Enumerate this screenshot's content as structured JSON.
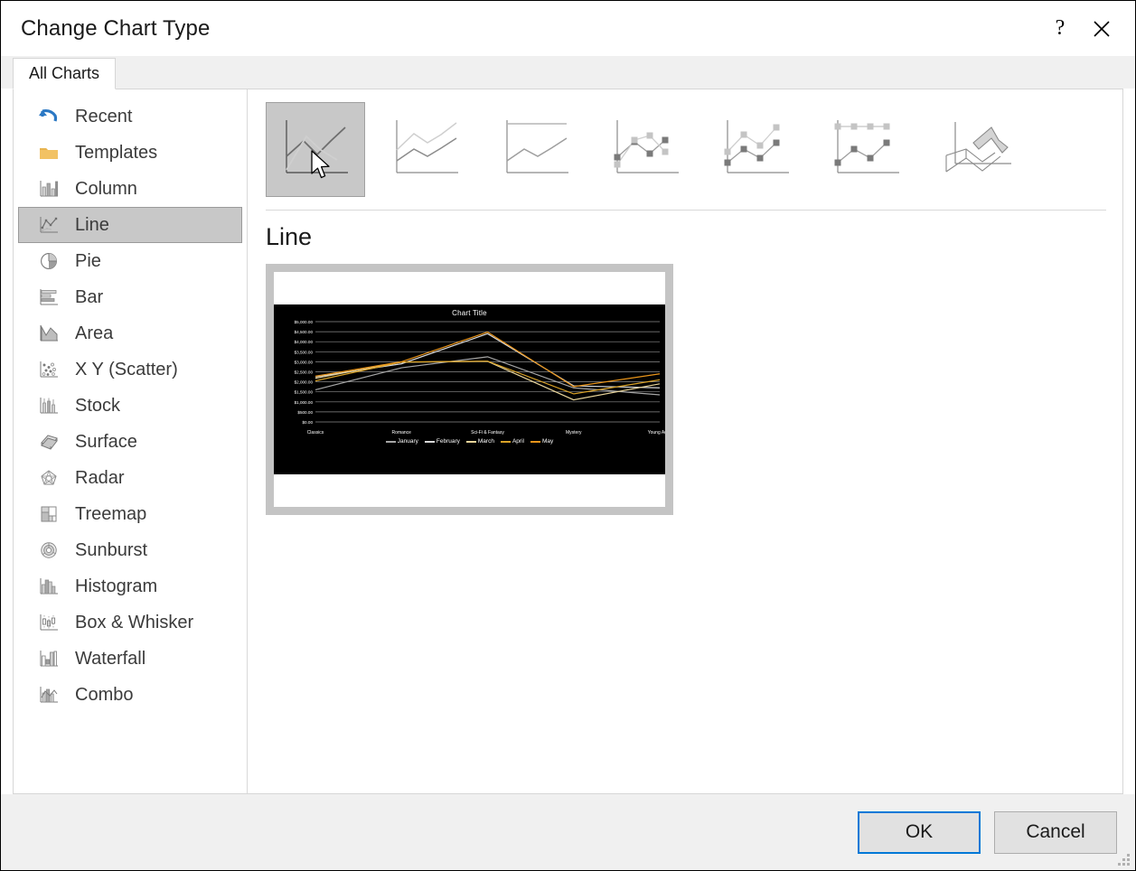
{
  "window": {
    "title": "Change Chart Type",
    "help_label": "?",
    "close_label": "✕"
  },
  "tabs": [
    {
      "label": "All Charts",
      "selected": true
    }
  ],
  "sidebar": {
    "items": [
      {
        "label": "Recent",
        "icon": "recent-undo-icon",
        "selected": false
      },
      {
        "label": "Templates",
        "icon": "folder-icon",
        "selected": false
      },
      {
        "label": "Column",
        "icon": "column-chart-icon",
        "selected": false
      },
      {
        "label": "Line",
        "icon": "line-chart-icon",
        "selected": true
      },
      {
        "label": "Pie",
        "icon": "pie-chart-icon",
        "selected": false
      },
      {
        "label": "Bar",
        "icon": "bar-chart-icon",
        "selected": false
      },
      {
        "label": "Area",
        "icon": "area-chart-icon",
        "selected": false
      },
      {
        "label": "X Y (Scatter)",
        "icon": "scatter-chart-icon",
        "selected": false
      },
      {
        "label": "Stock",
        "icon": "stock-chart-icon",
        "selected": false
      },
      {
        "label": "Surface",
        "icon": "surface-chart-icon",
        "selected": false
      },
      {
        "label": "Radar",
        "icon": "radar-chart-icon",
        "selected": false
      },
      {
        "label": "Treemap",
        "icon": "treemap-icon",
        "selected": false
      },
      {
        "label": "Sunburst",
        "icon": "sunburst-icon",
        "selected": false
      },
      {
        "label": "Histogram",
        "icon": "histogram-icon",
        "selected": false
      },
      {
        "label": "Box & Whisker",
        "icon": "box-whisker-icon",
        "selected": false
      },
      {
        "label": "Waterfall",
        "icon": "waterfall-icon",
        "selected": false
      },
      {
        "label": "Combo",
        "icon": "combo-chart-icon",
        "selected": false
      }
    ]
  },
  "subtypes": {
    "heading": "Line",
    "thumbnails": [
      {
        "name": "line",
        "selected": true
      },
      {
        "name": "stacked-line",
        "selected": false
      },
      {
        "name": "100-percent-stacked-line",
        "selected": false
      },
      {
        "name": "line-with-markers",
        "selected": false
      },
      {
        "name": "stacked-line-with-markers",
        "selected": false
      },
      {
        "name": "100-percent-stacked-line-markers",
        "selected": false
      },
      {
        "name": "3-d-line",
        "selected": false
      }
    ],
    "cursor": "mouse-pointer"
  },
  "chart_data": {
    "type": "line",
    "title": "Chart Title",
    "xlabel": "",
    "ylabel": "",
    "categories": [
      "Classics",
      "Romance",
      "Sci-Fi & Fantasy",
      "Mystery",
      "Young Adult"
    ],
    "ylim": [
      0,
      5000
    ],
    "yticks": [
      "$0.00",
      "$500.00",
      "$1,000.00",
      "$1,500.00",
      "$2,000.00",
      "$2,500.00",
      "$3,000.00",
      "$3,500.00",
      "$4,000.00",
      "$4,500.00",
      "$5,000.00"
    ],
    "grid": true,
    "legend_position": "bottom",
    "background": "#000000",
    "series": [
      {
        "name": "January",
        "color": "#a6a6a6",
        "values": [
          1600,
          2700,
          3250,
          1700,
          1350
        ]
      },
      {
        "name": "February",
        "color": "#d9d9d9",
        "values": [
          2250,
          2900,
          4400,
          1800,
          1700
        ]
      },
      {
        "name": "March",
        "color": "#e8d49a",
        "values": [
          2180,
          2980,
          3020,
          1100,
          1900
        ]
      },
      {
        "name": "April",
        "color": "#d9a227",
        "values": [
          2050,
          2990,
          3030,
          1400,
          2100
        ]
      },
      {
        "name": "May",
        "color": "#e8941a",
        "values": [
          2280,
          3000,
          4480,
          1760,
          2400
        ]
      }
    ]
  },
  "footer": {
    "ok_label": "OK",
    "cancel_label": "Cancel"
  },
  "colors": {
    "accent": "#0078d7",
    "selected_bg": "#c8c8c8",
    "footer_bg": "#f0f0f0"
  }
}
